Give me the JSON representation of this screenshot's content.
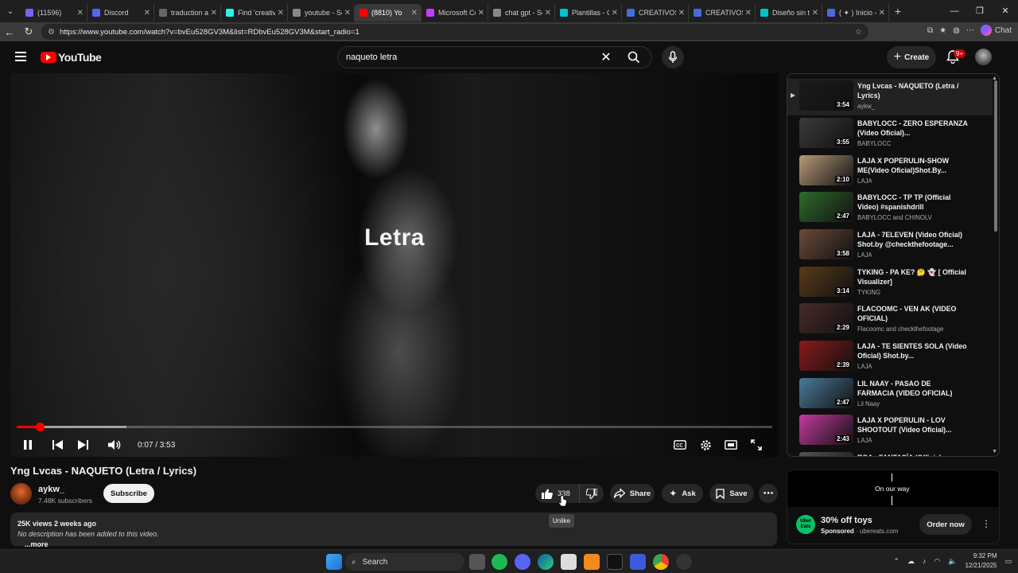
{
  "browser": {
    "tabs": [
      {
        "label": "(11596) ",
        "color": "#7b61ff"
      },
      {
        "label": "Discord",
        "color": "#5865f2"
      },
      {
        "label": "traduction an",
        "color": "#666666"
      },
      {
        "label": "Find 'creative",
        "color": "#25f4ee"
      },
      {
        "label": "youtube - Se",
        "color": "#888888"
      },
      {
        "label": "(8810) Yo",
        "color": "#ff0000"
      },
      {
        "label": "Microsoft Co",
        "color": "#c43cff"
      },
      {
        "label": "chat gpt - Se",
        "color": "#888888"
      },
      {
        "label": "Plantillas - Ca",
        "color": "#00c4cc"
      },
      {
        "label": "CREATIVOS R",
        "color": "#4a6bdf"
      },
      {
        "label": "CREATIVOS -",
        "color": "#4a6bdf"
      },
      {
        "label": "Diseño sin tít",
        "color": "#00c4cc"
      },
      {
        "label": "( ✦ ) Inicio -",
        "color": "#4a6bdf"
      }
    ],
    "active_tab": 5,
    "url": "https://www.youtube.com/watch?v=bvEu528GV3M&list=RDbvEu528GV3M&start_radio=1",
    "chat_label": "Chat"
  },
  "header": {
    "logo": "YouTube",
    "search_value": "naqueto letra",
    "create_label": "Create",
    "notif_badge": "9+"
  },
  "player": {
    "overlay_text": "Letra",
    "time": "0:07 / 3:53",
    "played_fraction": 0.03,
    "buffered_fraction": 0.145
  },
  "video": {
    "title": "Yng Lvcas - NAQUETO (Letra / Lyrics)",
    "channel": "aykw_",
    "subscribers": "7.48K subscribers",
    "subscribe_label": "Subscribe",
    "likes": "338",
    "share_label": "Share",
    "ask_label": "Ask",
    "save_label": "Save",
    "tooltip": "Unlike",
    "meta": "25K views  2 weeks ago",
    "description": "No description has been added to this video.",
    "more_label": "...more"
  },
  "playlist": [
    {
      "title": "Yng Lvcas - NAQUETO (Letra / Lyrics)",
      "channel": "aykw_",
      "duration": "3:54",
      "current": true,
      "thumb": "#1a1a1a"
    },
    {
      "title": "BABYLOCC - ZERO ESPERANZA (Video Oficial)...",
      "channel": "BABYLOCC",
      "duration": "3:55",
      "current": false,
      "thumb": "#3a3a3a"
    },
    {
      "title": "LAJA X POPERULIN-SHOW ME(Video Oficial)Shot.By...",
      "channel": "LAJA",
      "duration": "2:10",
      "current": false,
      "thumb": "#b89a7a"
    },
    {
      "title": "BABYLOCC - TP TP (Official Video) #spanishdrill",
      "channel": "BABYLOCC and CHINOLV",
      "duration": "2:47",
      "current": false,
      "thumb": "#2f6b2a"
    },
    {
      "title": "LAJA - 7ELEVEN (Video Oficial) Shot.by @checkthefootage...",
      "channel": "LAJA",
      "duration": "3:58",
      "current": false,
      "thumb": "#6a4a3a"
    },
    {
      "title": "TYKING - PA KE? 🤔 👻 [ Official Visualizer]",
      "channel": "TYKING",
      "duration": "3:14",
      "current": false,
      "thumb": "#5a3a1a"
    },
    {
      "title": "FLACOOMC - VEN AK (VIDEO OFICIAL)",
      "channel": "Flacoomc and checkthefootage",
      "duration": "2:29",
      "current": false,
      "thumb": "#4a2a2a"
    },
    {
      "title": "LAJA - TE SIENTES SOLA (Video Oficial) Shot.by...",
      "channel": "LAJA",
      "duration": "2:39",
      "current": false,
      "thumb": "#8a1a1a"
    },
    {
      "title": "LIL NAAY - PASAO DE FARMACIA (VIDEO OFICIAL)",
      "channel": "Lil Naay",
      "duration": "2:47",
      "current": false,
      "thumb": "#4a7a9a"
    },
    {
      "title": "LAJA X POPERULIN - LOV SHOOTOUT (Video Oficial)...",
      "channel": "LAJA",
      "duration": "2:43",
      "current": false,
      "thumb": "#c43aa0"
    },
    {
      "title": "ROA - FANTASÍA (Official",
      "channel": "",
      "duration": "",
      "current": false,
      "thumb": "#555555"
    }
  ],
  "ad": {
    "banner_text": "On our way",
    "headline": "30% off toys",
    "sponsored": "Sponsored",
    "domain": "ubereats.com",
    "cta": "Order now",
    "logo_text": "Uber Eats"
  },
  "taskbar": {
    "search_label": "Search",
    "time": "9:32 PM",
    "date": "12/21/2025"
  }
}
